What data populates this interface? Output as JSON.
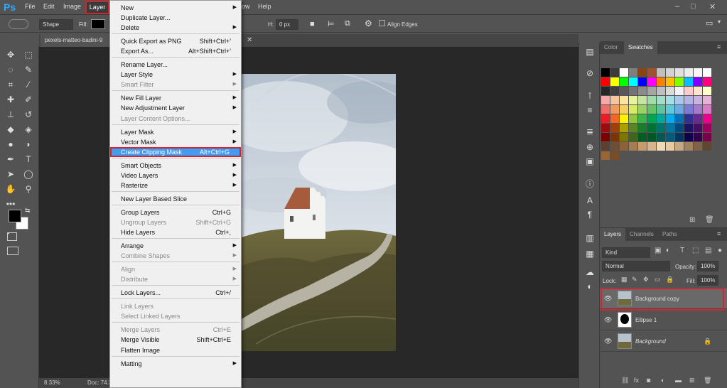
{
  "menubar": {
    "logo": "Ps",
    "items": [
      "File",
      "Edit",
      "Image",
      "Layer",
      "ow",
      "Help"
    ],
    "window_controls": [
      "–",
      "□",
      "✕"
    ]
  },
  "options": {
    "shape_mode": "Shape",
    "fill_label": "Fill:",
    "h_label": "H:",
    "h_value": "0 px",
    "align_edges": "Align Edges"
  },
  "document": {
    "tab_name": "pexels-matteo-badini-9",
    "zoom": "8.33%",
    "doc_info": "Doc: 74.3"
  },
  "layer_menu": {
    "items": [
      {
        "label": "New",
        "shortcut": "",
        "submenu": true,
        "disabled": false
      },
      {
        "label": "Duplicate Layer...",
        "shortcut": "",
        "submenu": false,
        "disabled": false
      },
      {
        "label": "Delete",
        "shortcut": "",
        "submenu": true,
        "disabled": false
      },
      {
        "sep": true
      },
      {
        "label": "Quick Export as PNG",
        "shortcut": "Shift+Ctrl+'",
        "submenu": false,
        "disabled": false
      },
      {
        "label": "Export As...",
        "shortcut": "Alt+Shift+Ctrl+'",
        "submenu": false,
        "disabled": false
      },
      {
        "sep": true
      },
      {
        "label": "Rename Layer...",
        "shortcut": "",
        "submenu": false,
        "disabled": false
      },
      {
        "label": "Layer Style",
        "shortcut": "",
        "submenu": true,
        "disabled": false
      },
      {
        "label": "Smart Filter",
        "shortcut": "",
        "submenu": true,
        "disabled": true
      },
      {
        "sep": true
      },
      {
        "label": "New Fill Layer",
        "shortcut": "",
        "submenu": true,
        "disabled": false
      },
      {
        "label": "New Adjustment Layer",
        "shortcut": "",
        "submenu": true,
        "disabled": false
      },
      {
        "label": "Layer Content Options...",
        "shortcut": "",
        "submenu": false,
        "disabled": true
      },
      {
        "sep": true
      },
      {
        "label": "Layer Mask",
        "shortcut": "",
        "submenu": true,
        "disabled": false
      },
      {
        "label": "Vector Mask",
        "shortcut": "",
        "submenu": true,
        "disabled": false
      },
      {
        "label": "Create Clipping Mask",
        "shortcut": "Alt+Ctrl+G",
        "submenu": false,
        "disabled": false,
        "highlight": true
      },
      {
        "sep": true
      },
      {
        "label": "Smart Objects",
        "shortcut": "",
        "submenu": true,
        "disabled": false
      },
      {
        "label": "Video Layers",
        "shortcut": "",
        "submenu": true,
        "disabled": false
      },
      {
        "label": "Rasterize",
        "shortcut": "",
        "submenu": true,
        "disabled": false
      },
      {
        "sep": true
      },
      {
        "label": "New Layer Based Slice",
        "shortcut": "",
        "submenu": false,
        "disabled": false
      },
      {
        "sep": true
      },
      {
        "label": "Group Layers",
        "shortcut": "Ctrl+G",
        "submenu": false,
        "disabled": false
      },
      {
        "label": "Ungroup Layers",
        "shortcut": "Shift+Ctrl+G",
        "submenu": false,
        "disabled": true
      },
      {
        "label": "Hide Layers",
        "shortcut": "Ctrl+,",
        "submenu": false,
        "disabled": false
      },
      {
        "sep": true
      },
      {
        "label": "Arrange",
        "shortcut": "",
        "submenu": true,
        "disabled": false
      },
      {
        "label": "Combine Shapes",
        "shortcut": "",
        "submenu": true,
        "disabled": true
      },
      {
        "sep": true
      },
      {
        "label": "Align",
        "shortcut": "",
        "submenu": true,
        "disabled": true
      },
      {
        "label": "Distribute",
        "shortcut": "",
        "submenu": true,
        "disabled": true
      },
      {
        "sep": true
      },
      {
        "label": "Lock Layers...",
        "shortcut": "Ctrl+/",
        "submenu": false,
        "disabled": false
      },
      {
        "sep": true
      },
      {
        "label": "Link Layers",
        "shortcut": "",
        "submenu": false,
        "disabled": true
      },
      {
        "label": "Select Linked Layers",
        "shortcut": "",
        "submenu": false,
        "disabled": true
      },
      {
        "sep": true
      },
      {
        "label": "Merge Layers",
        "shortcut": "Ctrl+E",
        "submenu": false,
        "disabled": true
      },
      {
        "label": "Merge Visible",
        "shortcut": "Shift+Ctrl+E",
        "submenu": false,
        "disabled": false
      },
      {
        "label": "Flatten Image",
        "shortcut": "",
        "submenu": false,
        "disabled": false
      },
      {
        "sep": true
      },
      {
        "label": "Matting",
        "shortcut": "",
        "submenu": true,
        "disabled": false
      }
    ]
  },
  "swatches_panel": {
    "tabs": [
      "Color",
      "Swatches"
    ],
    "colors": [
      [
        "#000000",
        "#3b3b3b",
        "#ffffff",
        "#7f7f7f",
        "#8b4513",
        "#a0522d",
        "#c0c0c0",
        "#d3d3d3",
        "#e0e0e0",
        "#ececec",
        "#f5f5f5",
        "#fafafa"
      ],
      [
        "#ff0000",
        "#ffff00",
        "#00ff00",
        "#00ffff",
        "#0000ff",
        "#ff00ff",
        "#ff8000",
        "#ffbf00",
        "#80ff00",
        "#00bfff",
        "#8000ff",
        "#ff0080"
      ],
      [
        "#262626",
        "#404040",
        "#595959",
        "#737373",
        "#8c8c8c",
        "#a6a6a6",
        "#bfbfbf",
        "#d9d9d9",
        "#f2f2f2",
        "#ffcccc",
        "#ffe5cc",
        "#ffffcc"
      ],
      [
        "#f7a8a8",
        "#f7c4a0",
        "#fbe4a0",
        "#e8f3a0",
        "#c5e6a3",
        "#a3dba8",
        "#a3dcc9",
        "#a3dde6",
        "#a7c8ec",
        "#b3b3e6",
        "#c9b1e0",
        "#e6b1d9"
      ],
      [
        "#f26a6a",
        "#f2995e",
        "#f7cf5e",
        "#d6ea66",
        "#99d266",
        "#66c466",
        "#5ec49e",
        "#5ec9d9",
        "#6aa9e6",
        "#7a7ad9",
        "#a37acc",
        "#d97ac4"
      ],
      [
        "#ed1c24",
        "#f26522",
        "#fff200",
        "#8dc63f",
        "#39b54a",
        "#00a651",
        "#00a99d",
        "#00aeef",
        "#0072bc",
        "#2e3192",
        "#662d91",
        "#ec008c"
      ],
      [
        "#9e0b0f",
        "#a0410d",
        "#aba000",
        "#598527",
        "#197b30",
        "#007236",
        "#00746b",
        "#0076a3",
        "#004a80",
        "#1b1464",
        "#440e62",
        "#9e005d"
      ],
      [
        "#7d0000",
        "#7d3400",
        "#7d7600",
        "#416619",
        "#005e20",
        "#005826",
        "#005952",
        "#005b7f",
        "#003663",
        "#0d004c",
        "#32004b",
        "#7b0046"
      ],
      [
        "#5c4033",
        "#6b4f3a",
        "#8c6239",
        "#a67c52",
        "#c69c6d",
        "#d8b48c",
        "#f0d9b5",
        "#e8c9a0",
        "#c8a882",
        "#a0825f",
        "#806346",
        "#60472f"
      ],
      [
        "#996633",
        "#7a4e24"
      ]
    ]
  },
  "layers_panel": {
    "tabs": [
      "Layers",
      "Channels",
      "Paths"
    ],
    "filter": "Kind",
    "blend_mode": "Normal",
    "opacity_label": "Opacity:",
    "opacity_value": "100%",
    "lock_label": "Lock:",
    "fill_label": "Fill:",
    "fill_value": "100%",
    "layers": [
      {
        "name": "Background copy",
        "selected": true
      },
      {
        "name": "Ellipse 1",
        "selected": false
      },
      {
        "name": "Background",
        "selected": false,
        "locked": true
      }
    ]
  }
}
